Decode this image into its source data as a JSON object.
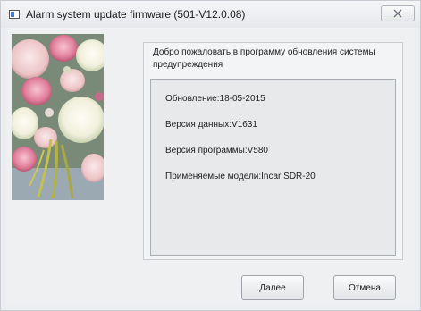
{
  "window": {
    "title": "Alarm system update firmware (501-V12.0.08)",
    "close_icon": "close-icon"
  },
  "wizard": {
    "welcome_text": "Добро пожаловать в программу обновления системы предупреждения",
    "info": [
      "Обновление:18-05-2015",
      "Версия данных:V1631",
      "Версия программы:V580",
      "Применяемые модели:Incar SDR-20"
    ],
    "side_image": "flower-bouquet-image"
  },
  "buttons": {
    "next_label": "Далее",
    "cancel_label": "Отмена"
  }
}
